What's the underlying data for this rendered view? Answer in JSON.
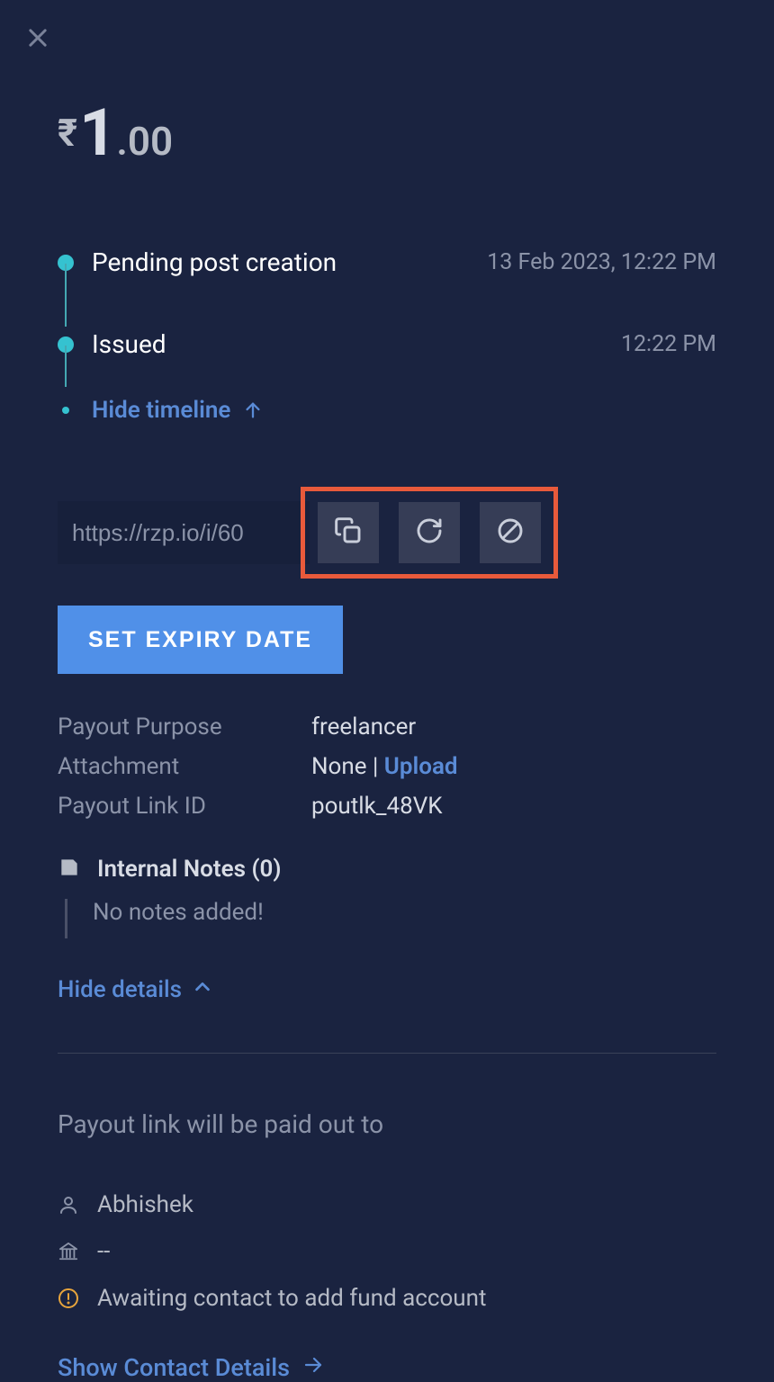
{
  "amount": {
    "currency_symbol": "₹",
    "integer": "1",
    "decimal": ".00"
  },
  "timeline": {
    "items": [
      {
        "label": "Pending post creation",
        "time": "13 Feb 2023, 12:22 PM"
      },
      {
        "label": "Issued",
        "time": "12:22 PM"
      }
    ],
    "hide_label": "Hide timeline"
  },
  "link": {
    "value": "https://rzp.io/i/60",
    "copy_icon": "copy-icon",
    "refresh_icon": "refresh-icon",
    "cancel_icon": "cancel-icon"
  },
  "set_expiry_label": "SET EXPIRY DATE",
  "details": {
    "purpose_label": "Payout Purpose",
    "purpose_value": "freelancer",
    "attachment_label": "Attachment",
    "attachment_value_none": "None",
    "attachment_sep": " | ",
    "attachment_upload": "Upload",
    "linkid_label": "Payout Link ID",
    "linkid_value": "poutlk_48VK"
  },
  "internal_notes": {
    "label": "Internal Notes (0)",
    "empty": "No notes added!"
  },
  "hide_details_label": "Hide details",
  "paid_out_heading": "Payout link will be paid out to",
  "contact": {
    "name": "Abhishek",
    "bank": "--",
    "status": "Awaiting contact to add fund account"
  },
  "show_contact_label": "Show Contact Details"
}
